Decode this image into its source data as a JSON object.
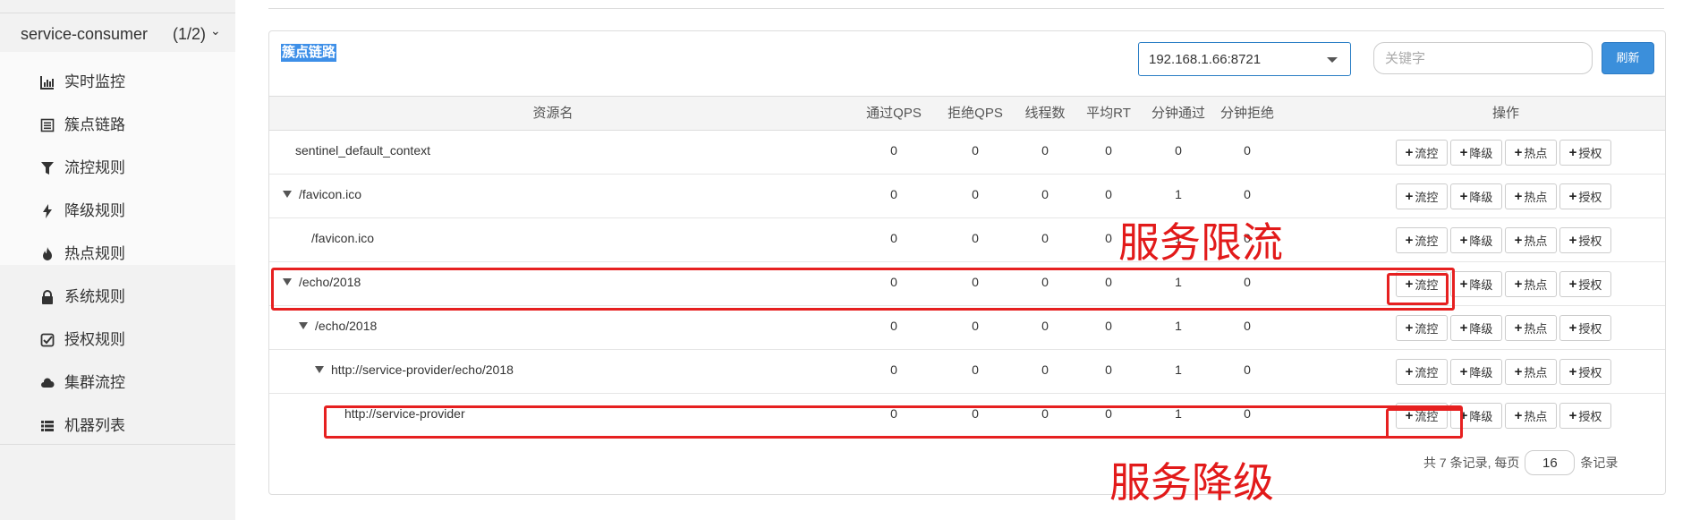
{
  "sidebar": {
    "app_name": "service-consumer",
    "app_count": "(1/2)",
    "items": [
      {
        "label": "实时监控",
        "icon": "bar-chart-icon"
      },
      {
        "label": "簇点链路",
        "icon": "list-icon"
      },
      {
        "label": "流控规则",
        "icon": "filter-icon"
      },
      {
        "label": "降级规则",
        "icon": "flash-icon"
      },
      {
        "label": "热点规则",
        "icon": "fire-icon"
      },
      {
        "label": "系统规则",
        "icon": "lock-icon"
      },
      {
        "label": "授权规则",
        "icon": "check-square-icon"
      },
      {
        "label": "集群流控",
        "icon": "cloud-icon"
      },
      {
        "label": "机器列表",
        "icon": "th-list-icon"
      }
    ]
  },
  "panel": {
    "title": "簇点链路",
    "machine_select": "192.168.1.66:8721",
    "keyword_placeholder": "关键字",
    "refresh_label": "刷新"
  },
  "table": {
    "headers": {
      "resource": "资源名",
      "pass_qps": "通过QPS",
      "block_qps": "拒绝QPS",
      "threads": "线程数",
      "avg_rt": "平均RT",
      "minute_pass": "分钟通过",
      "minute_block": "分钟拒绝",
      "actions": "操作"
    },
    "rows": [
      {
        "name": "sentinel_default_context",
        "expand": false,
        "values": [
          "0",
          "0",
          "0",
          "0",
          "0",
          "0"
        ]
      },
      {
        "name": "/favicon.ico",
        "expand": true,
        "values": [
          "0",
          "0",
          "0",
          "0",
          "1",
          "0"
        ]
      },
      {
        "name": "/favicon.ico",
        "expand": false,
        "values": [
          "0",
          "0",
          "0",
          "0",
          "1",
          "0"
        ]
      },
      {
        "name": "/echo/2018",
        "expand": true,
        "values": [
          "0",
          "0",
          "0",
          "0",
          "1",
          "0"
        ]
      },
      {
        "name": "/echo/2018",
        "expand": true,
        "values": [
          "0",
          "0",
          "0",
          "0",
          "1",
          "0"
        ]
      },
      {
        "name": "http://service-provider/echo/2018",
        "expand": true,
        "values": [
          "0",
          "0",
          "0",
          "0",
          "1",
          "0"
        ]
      },
      {
        "name": "http://service-provider",
        "expand": false,
        "values": [
          "0",
          "0",
          "0",
          "0",
          "1",
          "0"
        ]
      }
    ],
    "actions": {
      "flow": "流控",
      "degrade": "降级",
      "hotspot": "热点",
      "auth": "授权"
    }
  },
  "pagination": {
    "summary": "共 7 条记录, 每页",
    "page_size": "16",
    "suffix": "条记录"
  },
  "annotations": {
    "flow_limit": "服务限流",
    "degrade": "服务降级"
  },
  "colors": {
    "primary": "#3b8fdb",
    "annotation": "#e62020"
  }
}
